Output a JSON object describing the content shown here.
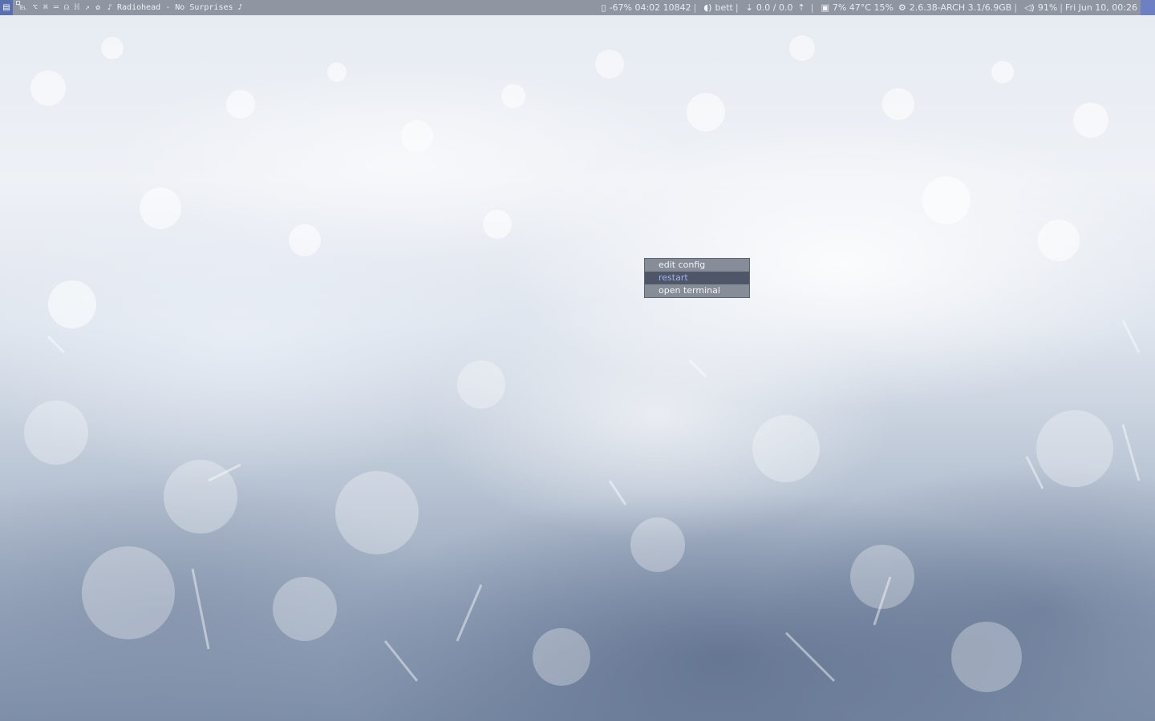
{
  "wallpaper": {
    "description_icon": "sparkle-bokeh"
  },
  "statusbar": {
    "layout_icon": "tile-layout-icon",
    "tags": [
      {
        "label": "℡",
        "occupied": true
      },
      {
        "label": "⌥",
        "occupied": false
      },
      {
        "label": "⌘",
        "occupied": false
      },
      {
        "label": "═",
        "occupied": false
      },
      {
        "label": "☊",
        "occupied": false
      },
      {
        "label": "ℍ",
        "occupied": false
      },
      {
        "label": "↗",
        "occupied": false
      },
      {
        "label": "✿",
        "occupied": false
      }
    ],
    "now_playing": "♪ Radiohead - No Surprises ♪",
    "battery": "-67% 04:02 10842",
    "wifi": "bett",
    "net": "0.0 / 0.0",
    "cpu": "7% 47°C 15%",
    "system": "2.6.38-ARCH 3.1/6.9GB",
    "volume": "91%",
    "datetime": "Fri Jun 10, 00:26",
    "separator": "|",
    "colors": {
      "bar_bg": "#767e8c",
      "layout_bg": "#5a6fae",
      "corner_bg": "#6e80c4"
    }
  },
  "menu": {
    "items": [
      {
        "label": "edit config",
        "active": false
      },
      {
        "label": "restart",
        "active": true
      },
      {
        "label": "open terminal",
        "active": false
      }
    ],
    "colors": {
      "bg": "#787e8a",
      "active_bg": "#4e5668",
      "active_fg": "#9fb3ee"
    }
  }
}
